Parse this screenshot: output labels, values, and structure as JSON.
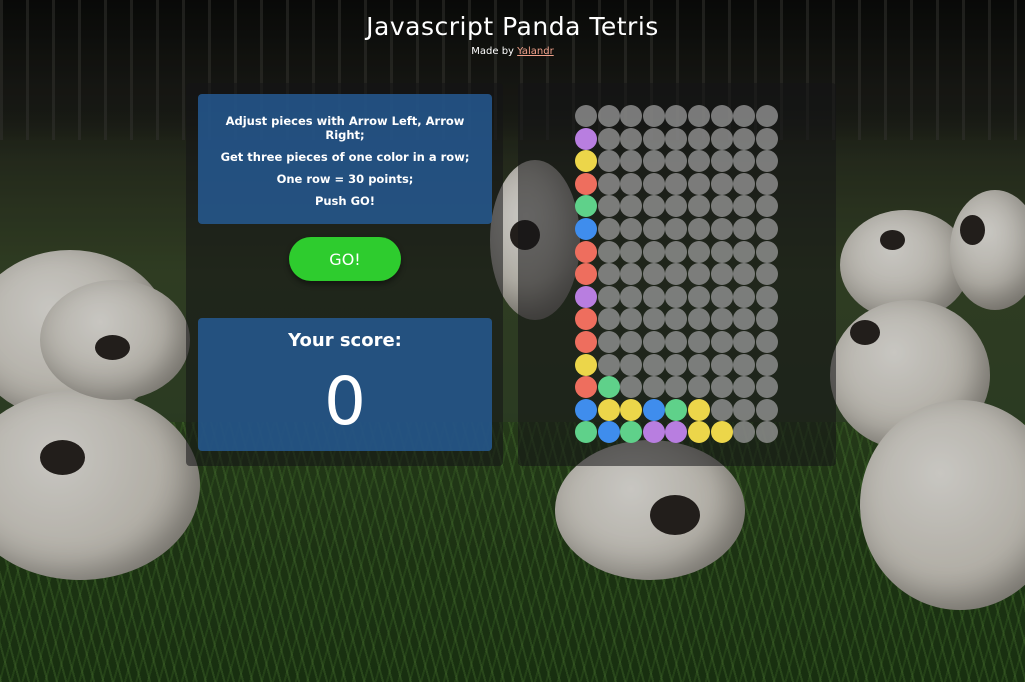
{
  "header": {
    "title": "Javascript Panda Tetris",
    "made_by_prefix": "Made by ",
    "author_link": "Yalandr"
  },
  "instructions": [
    "Adjust pieces with Arrow Left, Arrow Right;",
    "Get three pieces of one color in a row;",
    "One row = 30 points;",
    "Push GO!"
  ],
  "go_button": {
    "label": "GO!"
  },
  "score": {
    "label": "Your score:",
    "value": "0"
  },
  "colors": {
    "P": "#b87ee0",
    "Y": "#ecd64a",
    "R": "#ee6e5e",
    "G": "#5fd18a",
    "B": "#3f8ded",
    "empty": "#969696",
    "go_button": "#2ecc2e",
    "info_panel": "#265c96"
  },
  "board": {
    "columns": 9,
    "rows": 15,
    "cells": [
      ".........",
      "P........",
      "Y........",
      "R........",
      "G........",
      "B........",
      "R........",
      "R........",
      "P........",
      "R........",
      "R........",
      "Y........",
      "RG.......",
      "BYYBGY...",
      "GBGPPYY.."
    ]
  }
}
